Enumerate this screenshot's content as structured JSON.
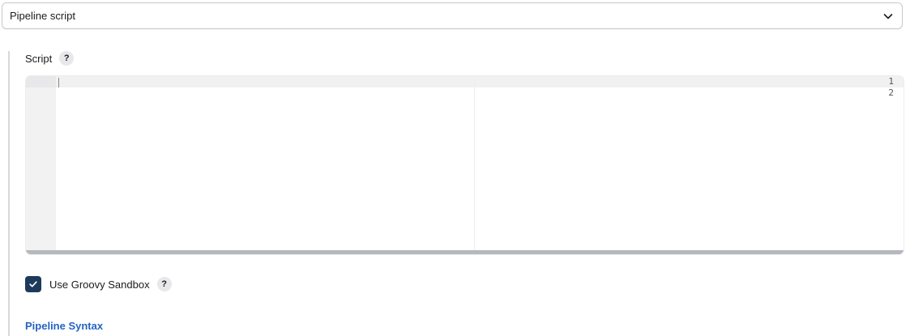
{
  "definition": {
    "selected": "Pipeline script"
  },
  "script": {
    "label": "Script",
    "help": "?",
    "line_numbers": [
      "1",
      "2"
    ]
  },
  "sandbox": {
    "label": "Use Groovy Sandbox",
    "checked": true,
    "help": "?"
  },
  "links": {
    "pipeline_syntax": "Pipeline Syntax"
  },
  "colors": {
    "checkbox": "#1d3a5c",
    "link": "#2762c5"
  }
}
